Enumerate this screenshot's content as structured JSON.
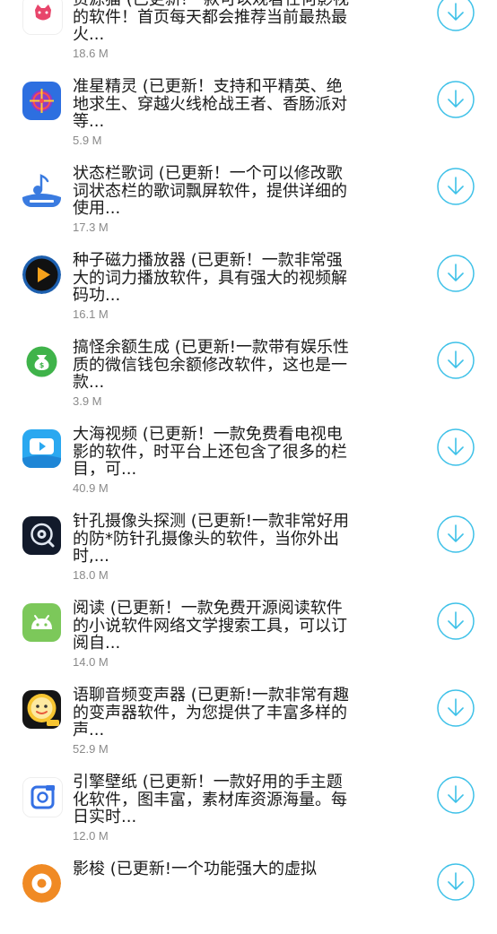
{
  "accent_color": "#3ec1e8",
  "apps": [
    {
      "icon": "cat-icon",
      "title": "资源猫 (已更新!一款可以观看任何影视的软件！首页每天都会推荐当前最热最火...",
      "size": "18.6 M"
    },
    {
      "icon": "crosshair-icon",
      "title": "准星精灵 (已更新！支持和平精英、绝地求生、穿越火线枪战王者、香肠派对等...",
      "size": "5.9 M"
    },
    {
      "icon": "music-note-icon",
      "title": "状态栏歌词 (已更新！一个可以修改歌词状态栏的歌词飘屏软件，提供详细的使用...",
      "size": "17.3 M"
    },
    {
      "icon": "play-icon",
      "title": "种子磁力播放器 (已更新！一款非常强大的词力播放软件，具有强大的视频解码功...",
      "size": "16.1 M"
    },
    {
      "icon": "money-bag-icon",
      "title": "搞怪余额生成 (已更新!一款带有娱乐性质的微信钱包余额修改软件，这也是一款...",
      "size": "3.9 M"
    },
    {
      "icon": "video-player-icon",
      "title": "大海视频 (已更新！一款免费看电视电影的软件，时平台上还包含了很多的栏目，可...",
      "size": "40.9 M"
    },
    {
      "icon": "camera-detector-icon",
      "title": "针孔摄像头探测 (已更新!一款非常好用的防*防针孔摄像头的软件，当你外出时,...",
      "size": "18.0 M"
    },
    {
      "icon": "android-icon",
      "title": "阅读 (已更新！一款免费开源阅读软件的小说软件网络文学搜索工具，可以订阅自...",
      "size": "14.0 M"
    },
    {
      "icon": "voice-changer-icon",
      "title": "语聊音频变声器 (已更新!一款非常有趣的变声器软件，为您提供了丰富多样的声...",
      "size": "52.9 M"
    },
    {
      "icon": "gallery-icon",
      "title": "引擎壁纸 (已更新！一款好用的手主题化软件，图丰富，素材库资源海量。每日实时...",
      "size": "12.0 M"
    },
    {
      "icon": "shuttle-icon",
      "title": "影梭 (已更新!一个功能强大的虚拟",
      "size": ""
    }
  ]
}
